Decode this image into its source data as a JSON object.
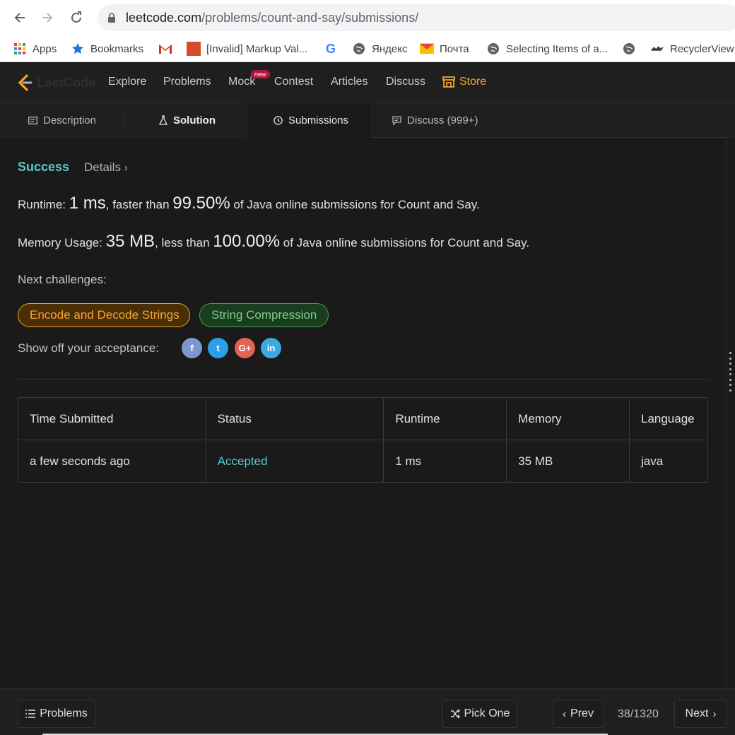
{
  "browser": {
    "url_host": "leetcode.com",
    "url_path": "/problems/count-and-say/submissions/",
    "bookmarks": [
      {
        "label": "Apps",
        "icon": "apps-grid-icon"
      },
      {
        "label": "Bookmarks",
        "icon": "star-icon"
      },
      {
        "label": "",
        "icon": "gmail-icon"
      },
      {
        "label": "[Invalid] Markup Val...",
        "icon": "w3c-icon"
      },
      {
        "label": "",
        "icon": "google-icon"
      },
      {
        "label": "Яндекс",
        "icon": "globe-icon"
      },
      {
        "label": "Почта",
        "icon": "mail-icon"
      },
      {
        "label": "Selecting Items of a...",
        "icon": "globe-icon"
      },
      {
        "label": "",
        "icon": "globe-icon"
      },
      {
        "label": "RecyclerView",
        "icon": "bird-icon"
      }
    ]
  },
  "nav": {
    "logo": "LeetCode",
    "links": [
      "Explore",
      "Problems",
      "Mock",
      "Contest",
      "Articles",
      "Discuss"
    ],
    "new_badge": "new",
    "store": "Store"
  },
  "tabs": [
    "Description",
    "Solution",
    "Submissions",
    "Discuss (999+)"
  ],
  "result": {
    "status": "Success",
    "details": "Details",
    "runtime_label": "Runtime: ",
    "runtime_value": "1 ms",
    "runtime_mid": ", faster than ",
    "runtime_pct": "99.50%",
    "runtime_tail": " of Java online submissions for Count and Say.",
    "memory_label": "Memory Usage: ",
    "memory_value": "35 MB",
    "memory_mid": ", less than ",
    "memory_pct": "100.00%",
    "memory_tail": " of Java online submissions for Count and Say.",
    "next_label": "Next challenges:",
    "challenges": [
      "Encode and Decode Strings",
      "String Compression"
    ],
    "share_label": "Show off your acceptance:",
    "social": [
      {
        "glyph": "f",
        "icon": "facebook-icon",
        "color": "#7b98d0"
      },
      {
        "glyph": "t",
        "icon": "twitter-icon",
        "color": "#2ba0e8"
      },
      {
        "glyph": "G+",
        "icon": "google-plus-icon",
        "color": "#e06453"
      },
      {
        "glyph": "in",
        "icon": "linkedin-icon",
        "color": "#3aa9e0"
      }
    ]
  },
  "table": {
    "headers": [
      "Time Submitted",
      "Status",
      "Runtime",
      "Memory",
      "Language"
    ],
    "rows": [
      [
        "a few seconds ago",
        "Accepted",
        "1 ms",
        "35 MB",
        "java"
      ]
    ]
  },
  "bottom": {
    "problems": "Problems",
    "pick_one": "Pick One",
    "prev": "Prev",
    "pager": "38/1320",
    "next": "Next"
  }
}
